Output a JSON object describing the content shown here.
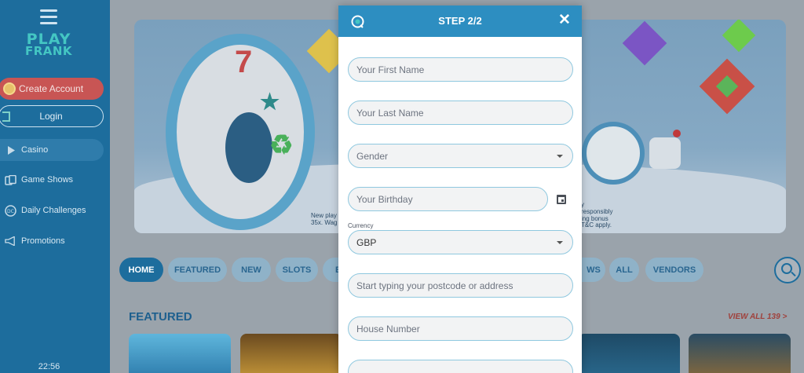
{
  "sidebar": {
    "logo_line1": "PLAY",
    "logo_line2": "FRANK",
    "create_account": "Create Account",
    "login": "Login",
    "items": [
      {
        "label": "Casino",
        "icon": "play-icon"
      },
      {
        "label": "Game Shows",
        "icon": "cards-icon"
      },
      {
        "label": "Daily Challenges",
        "icon": "dc-icon"
      },
      {
        "label": "Promotions",
        "icon": "megaphone-icon"
      }
    ],
    "clock": "22:56"
  },
  "hero": {
    "text_left_1": "New play",
    "text_left_2": "35x. Wag",
    "text_right_1": "y",
    "text_right_2": "responsibly",
    "text_right_3": "ing bonus",
    "text_right_4": "T&C apply."
  },
  "tabs": [
    "HOME",
    "FEATURED",
    "NEW",
    "SLOTS",
    "B",
    "WS",
    "ALL",
    "VENDORS"
  ],
  "featured": {
    "title": "FEATURED",
    "view_all": "VIEW ALL 139 >"
  },
  "modal": {
    "title": "STEP 2/2",
    "close": "✕",
    "first_name_placeholder": "Your First Name",
    "last_name_placeholder": "Your Last Name",
    "gender_placeholder": "Gender",
    "birthday_placeholder": "Your Birthday",
    "currency_label": "Currency",
    "currency_value": "GBP",
    "address_placeholder": "Start typing your postcode or address",
    "house_number_placeholder": "House Number"
  },
  "colors": {
    "sidebar": "#1d6d9d",
    "modal_header": "#2d8ec1",
    "create_account": "#c85554",
    "accent_teal": "#44c6c3"
  }
}
